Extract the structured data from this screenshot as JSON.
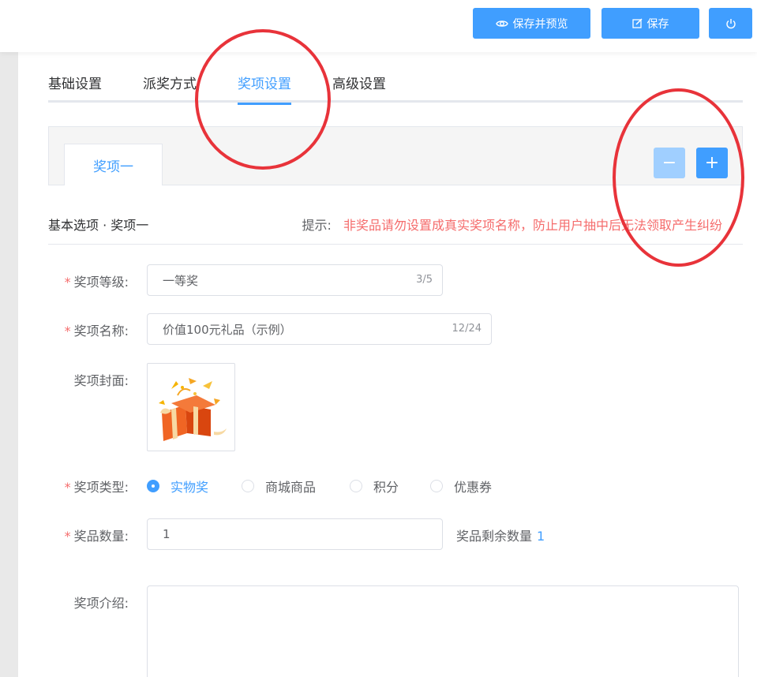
{
  "toolbar": {
    "preview_label": "保存并预览",
    "save_label": "保存",
    "preview_icon": "eye-icon",
    "save_icon": "edit-icon",
    "power_icon": "power-icon"
  },
  "tabs": [
    {
      "label": "基础设置",
      "active": false
    },
    {
      "label": "派奖方式",
      "active": false
    },
    {
      "label": "奖项设置",
      "active": true
    },
    {
      "label": "高级设置",
      "active": false
    }
  ],
  "prize_tabs": [
    {
      "label": "奖项一",
      "active": true
    }
  ],
  "prize_controls": {
    "remove_label": "−",
    "add_label": "+"
  },
  "section": {
    "title": "基本选项 · 奖项一",
    "tip_label": "提示:",
    "tip_text": "非奖品请勿设置成真实奖项名称，防止用户抽中后无法领取产生纠纷"
  },
  "form": {
    "level": {
      "label": "奖项等级:",
      "required": true,
      "value": "一等奖",
      "count": "3/5"
    },
    "name": {
      "label": "奖项名称:",
      "required": true,
      "value": "价值100元礼品（示例）",
      "count": "12/24"
    },
    "cover": {
      "label": "奖项封面:",
      "required": false
    },
    "type": {
      "label": "奖项类型:",
      "required": true,
      "options": [
        {
          "label": "实物奖",
          "checked": true
        },
        {
          "label": "商城商品",
          "checked": false
        },
        {
          "label": "积分",
          "checked": false
        },
        {
          "label": "优惠券",
          "checked": false
        }
      ]
    },
    "quantity": {
      "label": "奖品数量:",
      "required": true,
      "value": "1",
      "remain_label": "奖品剩余数量",
      "remain_value": "1"
    },
    "intro": {
      "label": "奖项介绍:",
      "required": false,
      "value": ""
    }
  },
  "colors": {
    "primary": "#409eff",
    "primary_light": "#a0cfff",
    "danger": "#f56c6c",
    "annotation": "#e8333a"
  }
}
